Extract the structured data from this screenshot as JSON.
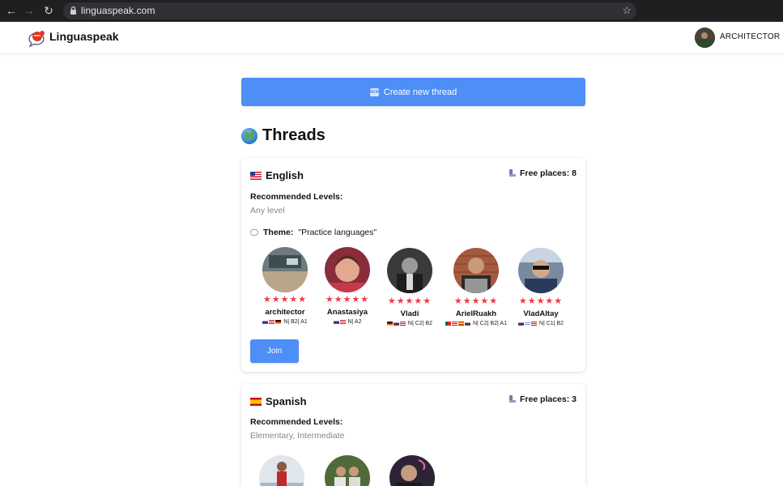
{
  "browser": {
    "url": "linguaspeak.com"
  },
  "app": {
    "name": "Linguaspeak",
    "user_name": "ARCHITECTOR"
  },
  "main": {
    "create_button_label": "Create new thread",
    "create_button_icon": "NEW",
    "section_title": "Threads"
  },
  "labels": {
    "recommended_levels": "Recommended Levels:",
    "free_places_prefix": "Free places: ",
    "theme_label": "Theme:",
    "join": "Join"
  },
  "threads": [
    {
      "language": "English",
      "flag": "us",
      "free_places": "Free places: 8",
      "recommended_levels": "Any level",
      "theme": "\"Practice languages\"",
      "members": [
        {
          "name": "architector",
          "levels": "N|  B2|  A1",
          "rating": 5
        },
        {
          "name": "Anastasiya",
          "levels": "N|  A2",
          "rating": 5
        },
        {
          "name": "Vladi",
          "levels": "N|  C2|  B2",
          "rating": 5
        },
        {
          "name": "ArielRuakh",
          "levels": "N|  C2|  B2|  A1",
          "rating": 5
        },
        {
          "name": "VladAltay",
          "levels": "N|  C1|  B2",
          "rating": 5
        }
      ],
      "join_label": "Join"
    },
    {
      "language": "Spanish",
      "flag": "es",
      "free_places": "Free places: 3",
      "recommended_levels": "Elementary, Intermediate"
    }
  ],
  "colors": {
    "accent": "#4d8ff7",
    "star": "#ee3b47"
  }
}
